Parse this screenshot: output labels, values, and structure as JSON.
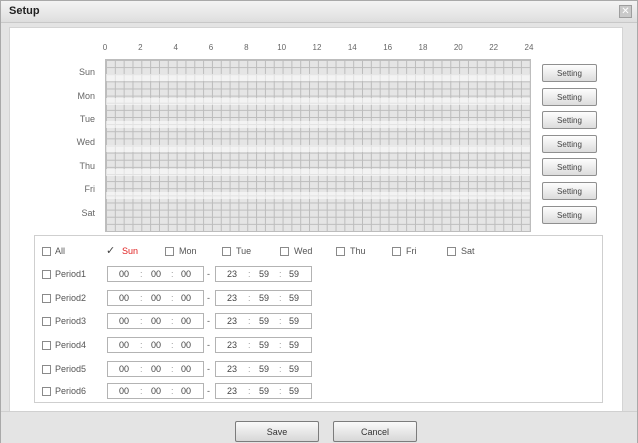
{
  "dialog": {
    "title": "Setup",
    "close_icon": "close-icon"
  },
  "timeline": {
    "hours": [
      "0",
      "2",
      "4",
      "6",
      "8",
      "10",
      "12",
      "14",
      "16",
      "18",
      "20",
      "22",
      "24"
    ]
  },
  "days": [
    {
      "label": "Sun",
      "button": "Setting"
    },
    {
      "label": "Mon",
      "button": "Setting"
    },
    {
      "label": "Tue",
      "button": "Setting"
    },
    {
      "label": "Wed",
      "button": "Setting"
    },
    {
      "label": "Thu",
      "button": "Setting"
    },
    {
      "label": "Fri",
      "button": "Setting"
    },
    {
      "label": "Sat",
      "button": "Setting"
    }
  ],
  "day_selector": {
    "all_label": "All",
    "options": [
      {
        "label": "Sun",
        "checked": true
      },
      {
        "label": "Mon",
        "checked": false
      },
      {
        "label": "Tue",
        "checked": false
      },
      {
        "label": "Wed",
        "checked": false
      },
      {
        "label": "Thu",
        "checked": false
      },
      {
        "label": "Fri",
        "checked": false
      },
      {
        "label": "Sat",
        "checked": false
      }
    ]
  },
  "periods": [
    {
      "label": "Period1",
      "start": [
        "00",
        "00",
        "00"
      ],
      "end": [
        "23",
        "59",
        "59"
      ]
    },
    {
      "label": "Period2",
      "start": [
        "00",
        "00",
        "00"
      ],
      "end": [
        "23",
        "59",
        "59"
      ]
    },
    {
      "label": "Period3",
      "start": [
        "00",
        "00",
        "00"
      ],
      "end": [
        "23",
        "59",
        "59"
      ]
    },
    {
      "label": "Period4",
      "start": [
        "00",
        "00",
        "00"
      ],
      "end": [
        "23",
        "59",
        "59"
      ]
    },
    {
      "label": "Period5",
      "start": [
        "00",
        "00",
        "00"
      ],
      "end": [
        "23",
        "59",
        "59"
      ]
    },
    {
      "label": "Period6",
      "start": [
        "00",
        "00",
        "00"
      ],
      "end": [
        "23",
        "59",
        "59"
      ]
    }
  ],
  "footer": {
    "save_label": "Save",
    "cancel_label": "Cancel"
  }
}
